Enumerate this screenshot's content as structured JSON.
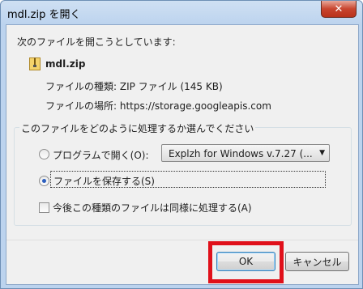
{
  "window": {
    "title": "mdl.zip を開く"
  },
  "dialog": {
    "prompt": "次のファイルを開こうとしています:",
    "file_name": "mdl.zip",
    "file_type": "ファイルの種類: ZIP ファイル (145 KB)",
    "file_from": "ファイルの場所: https://storage.googleapis.com",
    "group_title": "このファイルをどのように処理するか選んでください",
    "open_with_label": "プログラムで開く(O):",
    "open_with_app": "Explzh for Windows v.7.27 (...",
    "save_label": "ファイルを保存する(S)",
    "always_label": "今後この種類のファイルは同様に処理する(A)"
  },
  "buttons": {
    "ok": "OK",
    "cancel": "キャンセル"
  },
  "state": {
    "selected_option": "save",
    "always_checked": false
  },
  "colors": {
    "highlight": "#e0101a",
    "close": "#c8452f",
    "title_bg": "#bcd3ee"
  },
  "icons": {
    "close": "close-icon",
    "file": "zip-file-icon",
    "dropdown": "chevron-down-icon"
  }
}
